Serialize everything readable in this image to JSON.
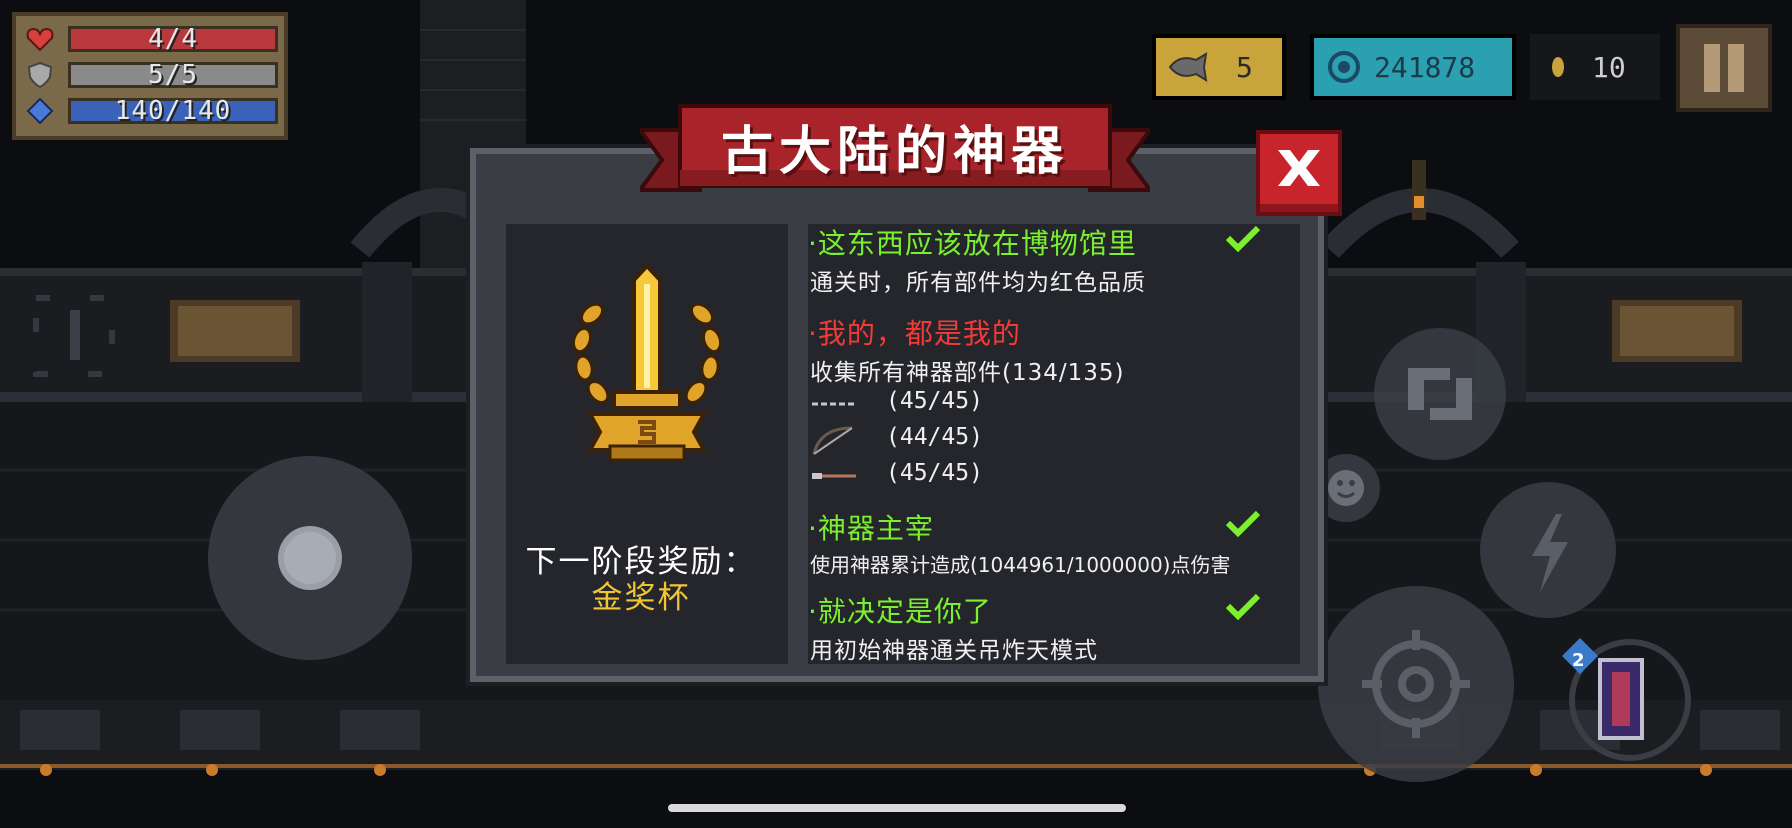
{
  "hud": {
    "health": "4/4",
    "armor": "5/5",
    "energy": "140/140",
    "fish_count": "5",
    "gems": "241878",
    "coins": "10"
  },
  "colors": {
    "health_bar": "#b8383c",
    "armor_bar": "#8a8a8a",
    "energy_bar": "#3a62b8",
    "fish_box": "#c9a43a",
    "gem_box": "#2aa0b0",
    "accent_green": "#7bf02e",
    "accent_red": "#f23a36",
    "reward_gold": "#f2c534"
  },
  "icons": {
    "health": "heart-icon",
    "armor": "shield-icon",
    "energy": "diamond-icon",
    "fish": "fish-icon",
    "gem": "gem-icon",
    "coin": "coin-icon",
    "pause": "pause-icon",
    "close": "close-icon",
    "trophy": "golden-sword-trophy-icon",
    "check": "check-icon",
    "emote": "smiley-icon",
    "skill": "lightning-icon",
    "swap": "swap-weapon-icon",
    "attack": "crosshair-icon"
  },
  "dialog": {
    "title": "古大陆的神器",
    "next_stage_label": "下一阶段奖励：",
    "next_stage_reward": "金奖杯",
    "achievements": [
      {
        "title": "·这东西应该放在博物馆里",
        "desc": "通关时，所有部件均为红色品质",
        "status": "complete",
        "color": "green"
      },
      {
        "title": "·我的，都是我的",
        "desc": "收集所有神器部件(134/135)",
        "status": "incomplete",
        "color": "red",
        "parts": [
          {
            "icon": "staff-part-icon",
            "count": "(45/45)"
          },
          {
            "icon": "bow-part-icon",
            "count": "(44/45)"
          },
          {
            "icon": "blade-part-icon",
            "count": "(45/45)"
          }
        ]
      },
      {
        "title": "·神器主宰",
        "desc": "使用神器累计造成(1044961/1000000)点伤害",
        "status": "complete",
        "color": "green"
      },
      {
        "title": "·就决定是你了",
        "desc": "用初始神器通关吊炸天模式",
        "status": "complete",
        "color": "green"
      }
    ]
  },
  "controls": {
    "secondary_weapon_level": "2"
  }
}
